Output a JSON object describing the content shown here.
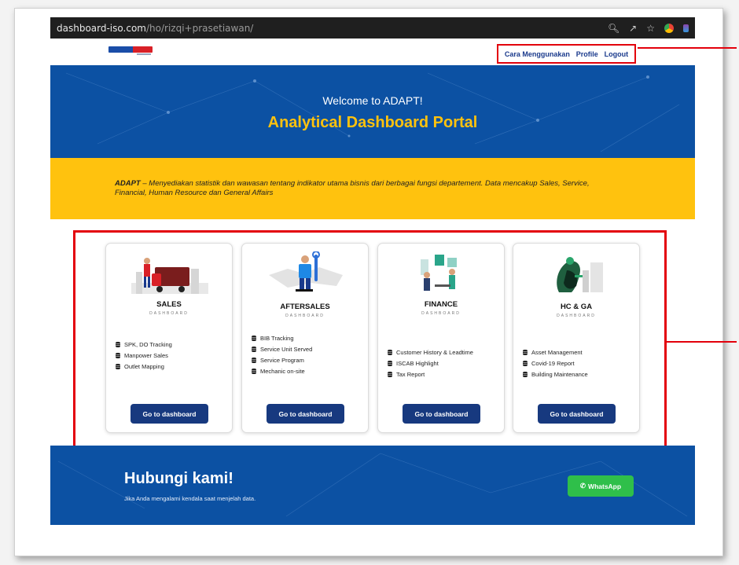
{
  "browser": {
    "url_host": "dashboard-iso.com",
    "url_path": "/ho/rizqi+prasetiawan/"
  },
  "nav": {
    "links": [
      "Cara Menggunakan",
      "Profile",
      "Logout"
    ]
  },
  "hero": {
    "welcome": "Welcome to ADAPT!",
    "title": "Analytical Dashboard Portal"
  },
  "intro": {
    "brand": "ADAPT",
    "text": " – Menyediakan statistik dan wawasan tentang indikator utama bisnis dari berbagai fungsi departement. Data mencakup Sales, Service, Financial, Human Resource dan General Affairs"
  },
  "cards": [
    {
      "title": "SALES",
      "subtitle": "DASHBOARD",
      "items": [
        "SPK, DO Tracking",
        "Manpower Sales",
        "Outlet Mapping"
      ],
      "button": "Go to dashboard"
    },
    {
      "title": "AFTERSALES",
      "subtitle": "DASHBOARD",
      "items": [
        "BIB Tracking",
        "Service Unit Served",
        "Service Program",
        "Mechanic on-site"
      ],
      "button": "Go to dashboard"
    },
    {
      "title": "FINANCE",
      "subtitle": "DASHBOARD",
      "items": [
        "Customer History & Leadtime",
        "ISCAB Highlight",
        "Tax Report"
      ],
      "button": "Go to dashboard"
    },
    {
      "title": "HC & GA",
      "subtitle": "DASHBOARD",
      "items": [
        "Asset Management",
        "Covid-19 Report",
        "Building Maintenance"
      ],
      "button": "Go to dashboard"
    }
  ],
  "footer": {
    "title": "Hubungi kami!",
    "text": "Jika Anda mengalami kendala saat menjelah data.",
    "whatsapp_label": "WhatsApp"
  },
  "colors": {
    "primary_blue": "#0c51a3",
    "accent_yellow": "#ffc20e",
    "button_navy": "#17397f",
    "annotation_red": "#e3000b",
    "whatsapp_green": "#2fbf4a"
  }
}
